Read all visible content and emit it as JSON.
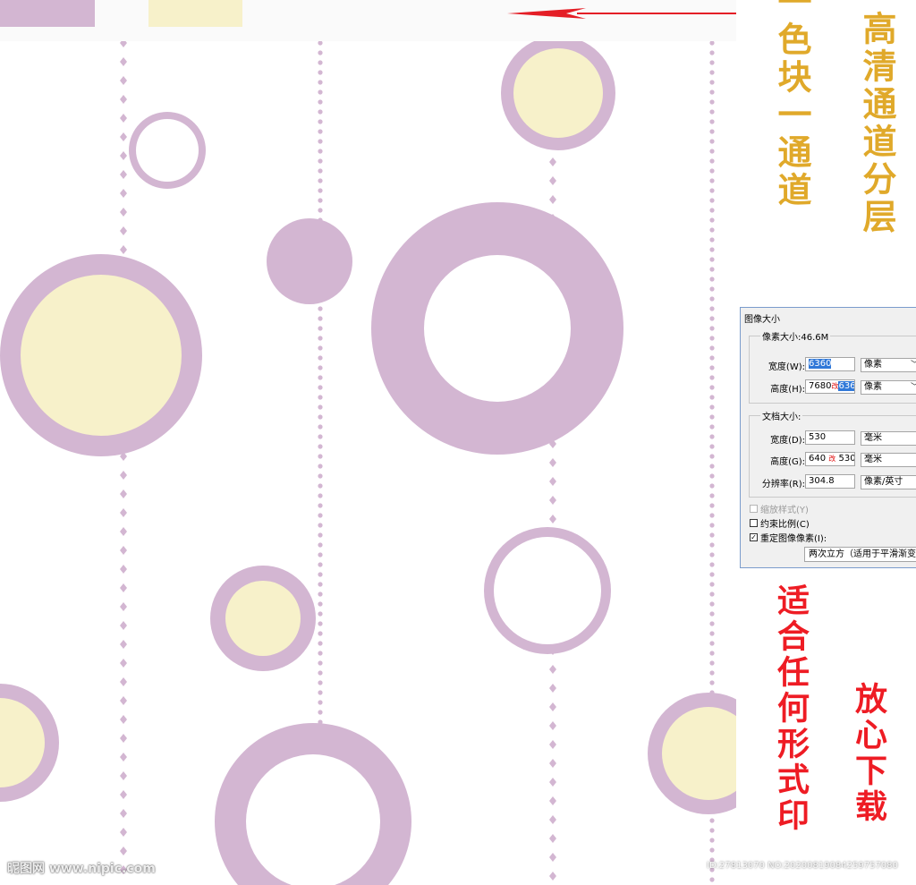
{
  "colors": {
    "lilac": "#d3b6d2",
    "cream": "#f7f1ca",
    "white": "#ffffff",
    "arrow": "#e41e26",
    "gold": "#e0a92a",
    "red": "#ee1c24"
  },
  "arrow_direction": "left",
  "side_text": {
    "color_channel": "一色块一通道",
    "hd_channel": "高清通道分层",
    "any_print": "适合任何形式印",
    "download": "放心下载"
  },
  "dialog": {
    "title": "图像大小",
    "pixel_size_label": "像素大小:46.6M",
    "width_label": "宽度(W):",
    "width_value": "6360",
    "width_unit": "像素",
    "height_label": "高度(H):",
    "height_old": "7680",
    "height_mark": "改",
    "height_value": "6360",
    "height_unit": "像素",
    "doc_size_label": "文档大小:",
    "doc_width_label": "宽度(D):",
    "doc_width_value": "530",
    "doc_width_unit": "毫米",
    "doc_height_label": "高度(G):",
    "doc_height_old": "640",
    "doc_height_mark": "改",
    "doc_height_value": "530",
    "doc_height_unit": "毫米",
    "resolution_label": "分辨率(R):",
    "resolution_value": "304.8",
    "resolution_unit": "像素/英寸",
    "scale_styles_label": "缩放样式(Y)",
    "constrain_label": "约束比例(C)",
    "resample_label": "重定图像像素(I):",
    "resample_method": "两次立方（适用于平滑渐变"
  },
  "watermark": {
    "site": "昵图网 www.nipic.com",
    "id_text": "ID:27813070 NO:20200819084259757080"
  }
}
